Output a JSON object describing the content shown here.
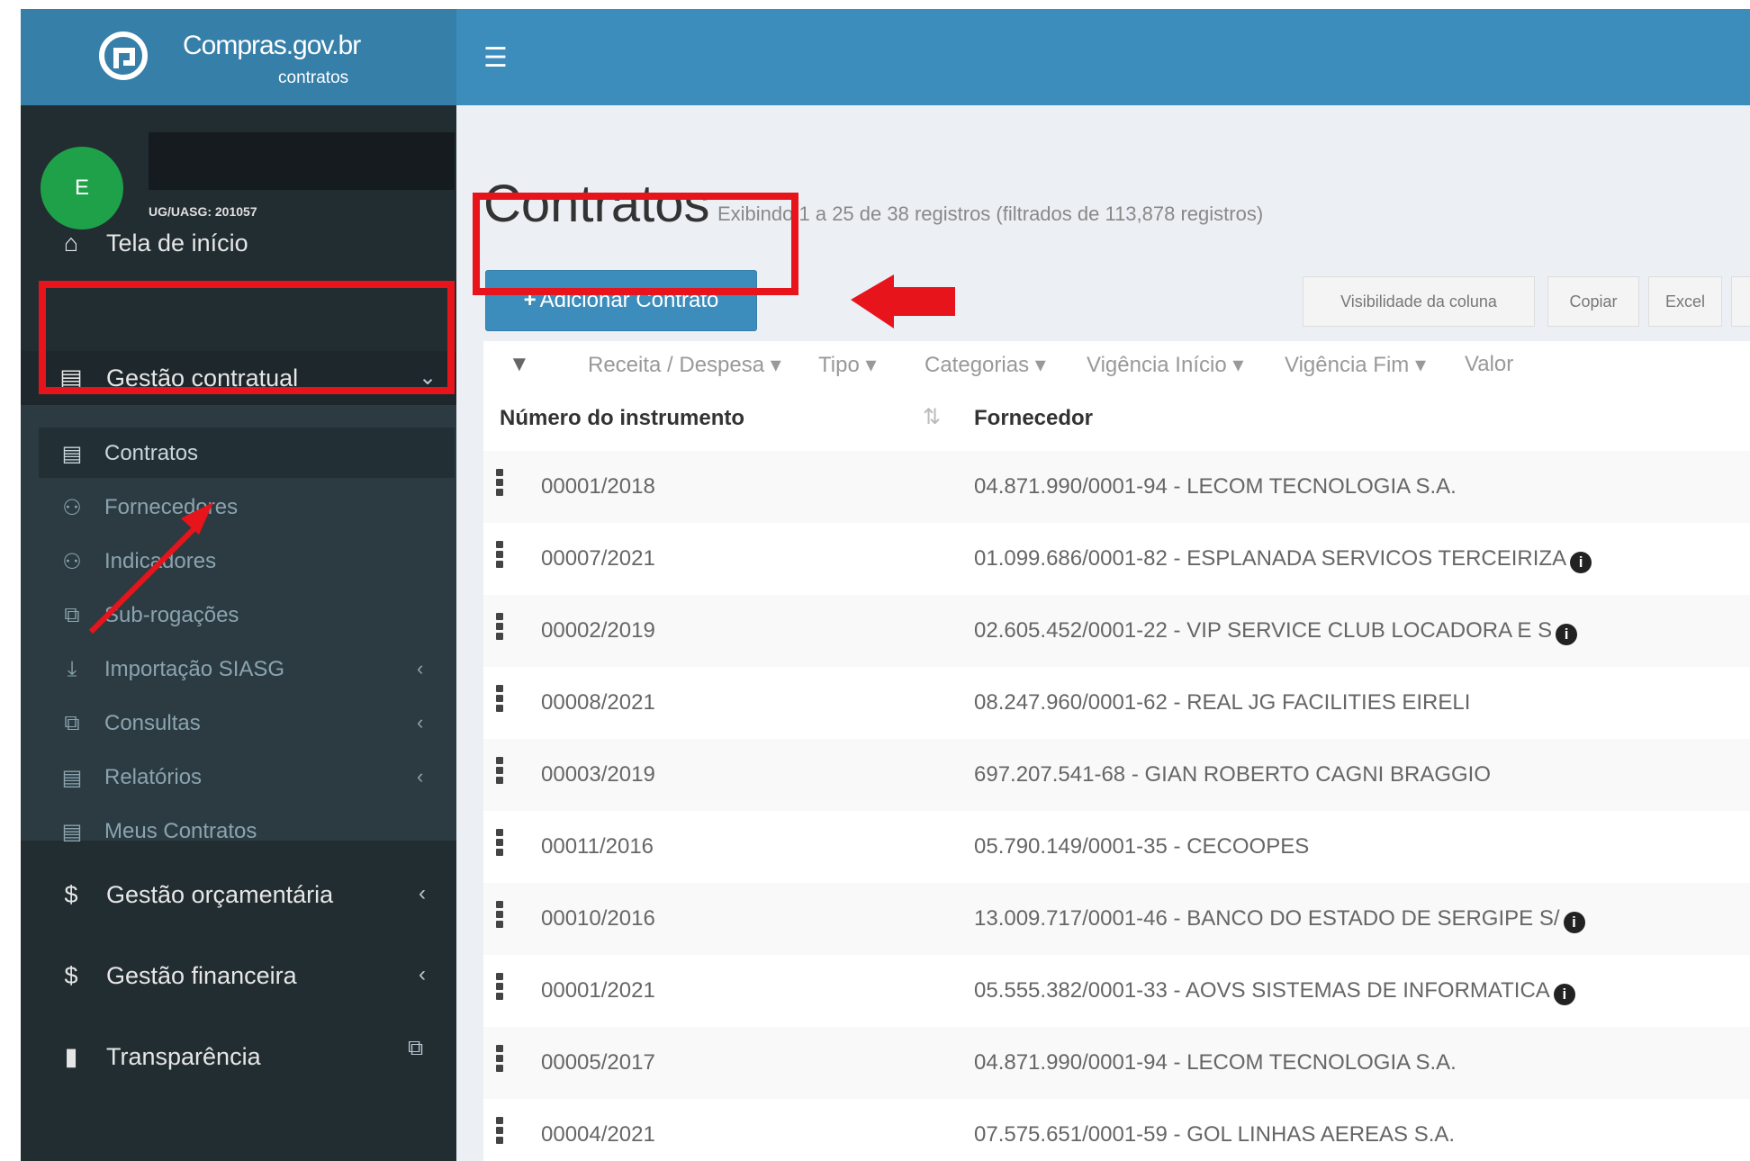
{
  "brand": {
    "name": "Compras.gov.br",
    "sub": "contratos"
  },
  "user": {
    "initial": "E",
    "uasg": "UG/UASG: 201057"
  },
  "sidebar": {
    "items": [
      {
        "label": "Tela de início",
        "icon": "home-icon"
      },
      {
        "label": "Gestão contratual",
        "icon": "document-icon"
      }
    ],
    "subitems": [
      {
        "label": "Contratos",
        "icon": "document-icon"
      },
      {
        "label": "Fornecedores",
        "icon": "users-icon"
      },
      {
        "label": "Indicadores",
        "icon": "users-icon"
      },
      {
        "label": "Sub-rogações",
        "icon": "copy-icon"
      },
      {
        "label": "Importação SIASG",
        "icon": "download-icon"
      },
      {
        "label": "Consultas",
        "icon": "copy-icon"
      },
      {
        "label": "Relatórios",
        "icon": "document-icon"
      },
      {
        "label": "Meus Contratos",
        "icon": "document-icon"
      }
    ],
    "bottom": [
      {
        "label": "Gestão orçamentária",
        "icon": "dollar-icon"
      },
      {
        "label": "Gestão financeira",
        "icon": "dollar-icon"
      },
      {
        "label": "Transparência",
        "icon": "id-card-icon"
      }
    ]
  },
  "page": {
    "title": "Contratos",
    "subtitle": "Exibindo 1 a 25 de 38 registros (filtrados de 113,878 registros)",
    "add_button": "Adicionar Contrato"
  },
  "toolbar": {
    "visibility": "Visibilidade da coluna",
    "copy": "Copiar",
    "excel": "Excel"
  },
  "filters": [
    "Receita / Despesa",
    "Tipo",
    "Categorias",
    "Vigência Início",
    "Vigência Fim",
    "Valor"
  ],
  "table": {
    "columns": [
      "Número do instrumento",
      "Fornecedor"
    ],
    "rows": [
      {
        "numero": "00001/2018",
        "fornecedor": "04.871.990/0001-94 - LECOM TECNOLOGIA S.A.",
        "info": false
      },
      {
        "numero": "00007/2021",
        "fornecedor": "01.099.686/0001-82 - ESPLANADA SERVICOS TERCEIRIZA",
        "info": true
      },
      {
        "numero": "00002/2019",
        "fornecedor": "02.605.452/0001-22 - VIP SERVICE CLUB LOCADORA E S",
        "info": true
      },
      {
        "numero": "00008/2021",
        "fornecedor": "08.247.960/0001-62 - REAL JG FACILITIES EIRELI",
        "info": false
      },
      {
        "numero": "00003/2019",
        "fornecedor": "697.207.541-68 - GIAN ROBERTO CAGNI BRAGGIO",
        "info": false
      },
      {
        "numero": "00011/2016",
        "fornecedor": "05.790.149/0001-35 - CECOOPES",
        "info": false
      },
      {
        "numero": "00010/2016",
        "fornecedor": "13.009.717/0001-46 - BANCO DO ESTADO DE SERGIPE S/",
        "info": true
      },
      {
        "numero": "00001/2021",
        "fornecedor": "05.555.382/0001-33 - AOVS SISTEMAS DE INFORMATICA",
        "info": true
      },
      {
        "numero": "00005/2017",
        "fornecedor": "04.871.990/0001-94 - LECOM TECNOLOGIA S.A.",
        "info": false
      },
      {
        "numero": "00004/2021",
        "fornecedor": "07.575.651/0001-59 - GOL LINHAS AEREAS S.A.",
        "info": false
      }
    ]
  },
  "colors": {
    "topbar": "#3c8dbc",
    "sidebar": "#222d32",
    "annotation": "#e8141b",
    "avatar": "#1fa14a"
  }
}
